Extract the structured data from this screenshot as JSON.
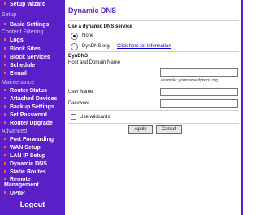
{
  "sidebar": {
    "setup_wizard": "Setup Wizard",
    "sections": {
      "setup": "Setup",
      "content_filtering": "Content Filtering",
      "maintenance": "Maintenance",
      "advanced": "Advanced"
    },
    "items": [
      "Basic Settings",
      "Logs",
      "Block Sites",
      "Block Services",
      "Schedule",
      "E-mail",
      "Router Status",
      "Attached Devices",
      "Backup Settings",
      "Set Password",
      "Router Upgrade",
      "Port Forwarding",
      "WAN Setup",
      "LAN IP Setup",
      "Dynamic DNS",
      "Static Routes",
      "Remote Management",
      "UPnP"
    ],
    "logout": "Logout"
  },
  "main": {
    "title": "Dynamic DNS",
    "use_service_label": "Use a dynamic DNS service",
    "options": {
      "none": "None",
      "dyndns": "DynDNS.org"
    },
    "click_here": "Click here for information",
    "dyndns_section": "DynDNS",
    "host_label": "Host and Domain Name",
    "host_example": "example: yourname.dyndns.org",
    "user_label": "User Name",
    "pass_label": "Password",
    "wildcards_label": "Use wildcards",
    "apply_label": "Apply",
    "cancel_label": "Cancel"
  }
}
